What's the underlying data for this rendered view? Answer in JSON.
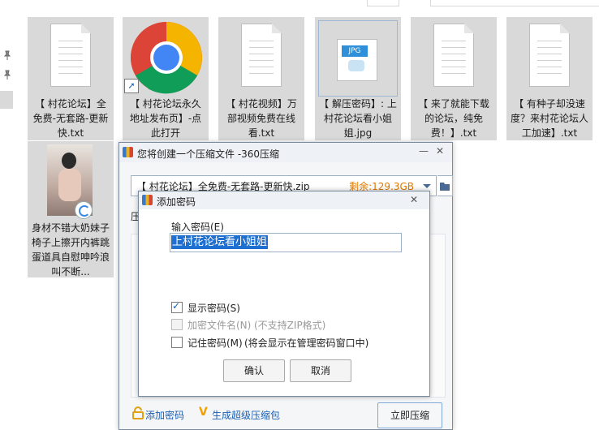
{
  "files": [
    {
      "name": "【 村花论坛】全免费-无套路-更新快.txt",
      "type": "txt"
    },
    {
      "name": "【 村花论坛永久地址发布页】-点此打开",
      "type": "shortcut-chrome"
    },
    {
      "name": "【 村花视频】万部视频免费在线看.txt",
      "type": "txt"
    },
    {
      "name": "【 解压密码】: 上村花论坛看小姐姐.jpg",
      "type": "jpg"
    },
    {
      "name": "【 来了就能下载的论坛，纯免费！】.txt",
      "type": "txt"
    },
    {
      "name": "【 有种子却没速度？来村花论坛人工加速】.txt",
      "type": "txt"
    },
    {
      "name": "身材不错大奶妹子椅子上擦开内裤跳蛋道具自慰呻吟浪叫不断...",
      "type": "video"
    }
  ],
  "compress_dialog": {
    "title": "您将创建一个压缩文件 -360压缩",
    "path": "【 村花论坛】全免费-无套路-更新快.zip",
    "remaining": "剩余:129.3GB",
    "compress_label": "压",
    "add_password_link": "添加密码",
    "super_package_link": "生成超级压缩包",
    "compress_button": "立即压缩"
  },
  "password_dialog": {
    "title": "添加密码",
    "input_label": "输入密码(E)",
    "password_value": "上村花论坛看小姐姐",
    "show_password": {
      "label": "显示密码(S)",
      "checked": true
    },
    "encrypt_filenames": {
      "label": "加密文件名(N)",
      "note": "(不支持ZIP格式)",
      "checked": false,
      "disabled": true
    },
    "remember_password": {
      "label": "记住密码(M)",
      "note": "(将会显示在管理密码窗口中)",
      "checked": false
    },
    "ok_button": "确认",
    "cancel_button": "取消"
  },
  "colors": {
    "accent": "#1e6fd0",
    "link": "#1a5fb4",
    "remaining": "#e07a00",
    "tile_selected": "#d9d9d9"
  }
}
